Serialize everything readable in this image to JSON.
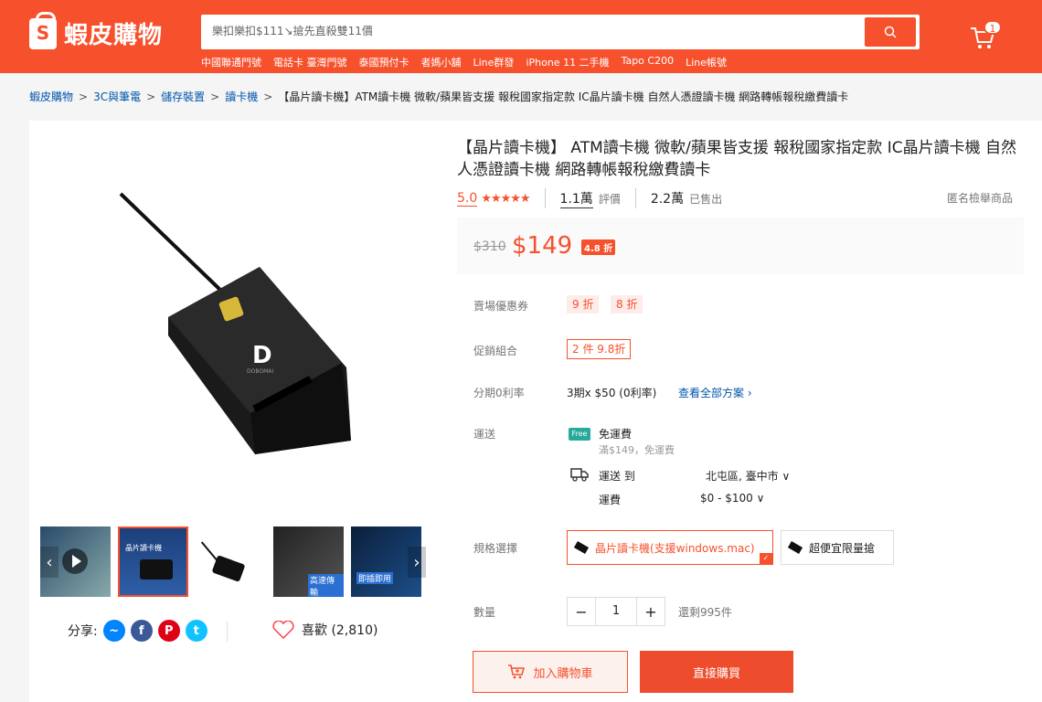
{
  "header": {
    "logo_mark": "S",
    "logo_text": "蝦皮購物",
    "search_value": "樂扣樂扣$111↘搶先直殺雙11價",
    "hot_words": [
      "中國聯通門號",
      "電話卡 臺灣門號",
      "泰國預付卡",
      "者媽小舖",
      "Line群發",
      "iPhone 11 二手機",
      "Tapo C200",
      "Line帳號"
    ],
    "cart_count": "1"
  },
  "breadcrumb": {
    "items": [
      "蝦皮購物",
      "3C與筆電",
      "儲存裝置",
      "讀卡機"
    ],
    "separator": ">",
    "current": "【晶片讀卡機】ATM讀卡機 微軟/蘋果皆支援 報稅國家指定款 IC晶片讀卡機 自然人憑證讀卡機 網路轉帳報稅繳費讀卡"
  },
  "product": {
    "title": "【晶片讀卡機】 ATM讀卡機 微軟/蘋果皆支援 報稅國家指定款 IC晶片讀卡機 自然人憑證讀卡機 網路轉帳報稅繳費讀卡",
    "rating": "5.0",
    "stars": "★★★★★",
    "review_count": "1.1萬",
    "review_label": "評價",
    "sold_count": "2.2萬",
    "sold_label": "已售出",
    "report": "匿名檢舉商品",
    "old_price": "$310",
    "price": "$149",
    "discount": "4.8 折",
    "brand_mark": "D",
    "brand_name": "DOBOMAI"
  },
  "details": {
    "voucher_label": "賣場優惠券",
    "vouchers": [
      "9 折",
      "8 折"
    ],
    "combo_label": "促銷組合",
    "combo": "2 件 9.8折",
    "installment_label": "分期0利率",
    "installment_value": "3期x $50 (0利率)",
    "installment_link": "查看全部方案 ›",
    "shipping_label": "運送",
    "free_icon": "Free",
    "free_shipping": "免運費",
    "free_shipping_sub": "滿$149，免運費",
    "ship_to_label": "運送 到",
    "ship_to_value": "北屯區, 臺中市 ∨",
    "fee_label": "運費",
    "fee_value": "$0 - $100 ∨",
    "variant_label": "規格選擇",
    "variants": [
      "晶片讀卡機(支援windows.mac)",
      "超便宜限量搶"
    ],
    "qty_label": "數量",
    "qty_value": "1",
    "stock": "還剩995件",
    "add_to_cart": "加入購物車",
    "buy_now": "直接購買"
  },
  "gallery": {
    "thumb_texts": [
      "",
      "晶片讀卡機",
      "",
      "高速傳輸",
      "即插即用"
    ],
    "prev": "‹",
    "next": "›"
  },
  "social": {
    "share_label": "分享:",
    "likes": "喜歡 (2,810)"
  },
  "colors": {
    "brand": "#f6512c",
    "link": "#0055aa",
    "free_ship": "#26aa99"
  }
}
